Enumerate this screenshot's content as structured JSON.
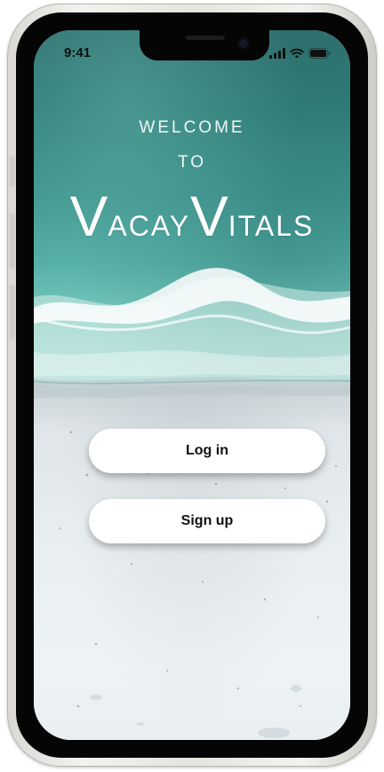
{
  "status_bar": {
    "time": "9:41",
    "icons": [
      "signal-icon",
      "wifi-icon",
      "battery-icon"
    ]
  },
  "welcome": {
    "line1": "WELCOME",
    "line2": "TO",
    "app_name_cap1": "V",
    "app_name_rest1": "acay",
    "app_name_cap2": "V",
    "app_name_rest2": "itals"
  },
  "actions": {
    "login_label": "Log in",
    "signup_label": "Sign up"
  },
  "colors": {
    "sea": "#2f7d78",
    "sand": "#eef2f4",
    "button_bg": "#ffffff",
    "button_text": "#111111"
  }
}
